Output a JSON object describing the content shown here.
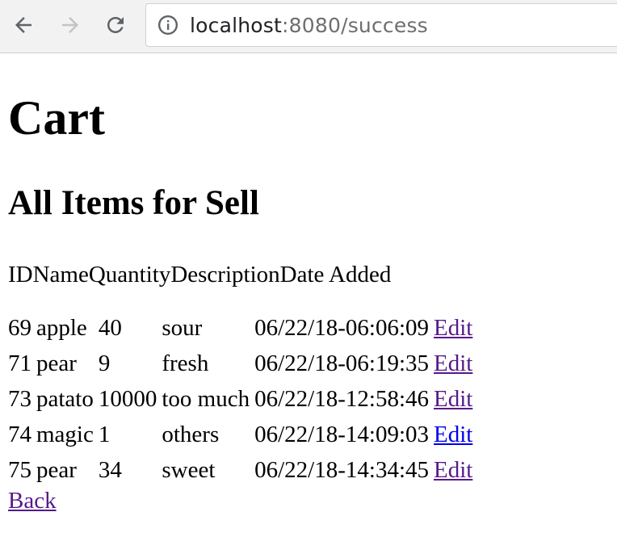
{
  "browser": {
    "url_host": "localhost",
    "url_rest": ":8080/success"
  },
  "page": {
    "title": "Cart",
    "subtitle": "All Items for Sell",
    "header_text": "IDNameQuantityDescriptionDate Added",
    "back_label": "Back"
  },
  "table": {
    "rows": [
      {
        "id": "69",
        "name": "apple",
        "quantity": "40",
        "description": "sour",
        "date": "06/22/18-06:06:09",
        "action": "Edit"
      },
      {
        "id": "71",
        "name": "pear",
        "quantity": "9",
        "description": "fresh",
        "date": "06/22/18-06:19:35",
        "action": "Edit"
      },
      {
        "id": "73",
        "name": "patato",
        "quantity": "10000",
        "description": "too much",
        "date": "06/22/18-12:58:46",
        "action": "Edit"
      },
      {
        "id": "74",
        "name": "magic",
        "quantity": "1",
        "description": "others",
        "date": "06/22/18-14:09:03",
        "action": "Edit"
      },
      {
        "id": "75",
        "name": "pear",
        "quantity": "34",
        "description": "sweet",
        "date": "06/22/18-14:34:45",
        "action": "Edit"
      }
    ]
  },
  "colors": {
    "visited_link": "#551a8b",
    "unvisited_link": "#0000ee"
  }
}
